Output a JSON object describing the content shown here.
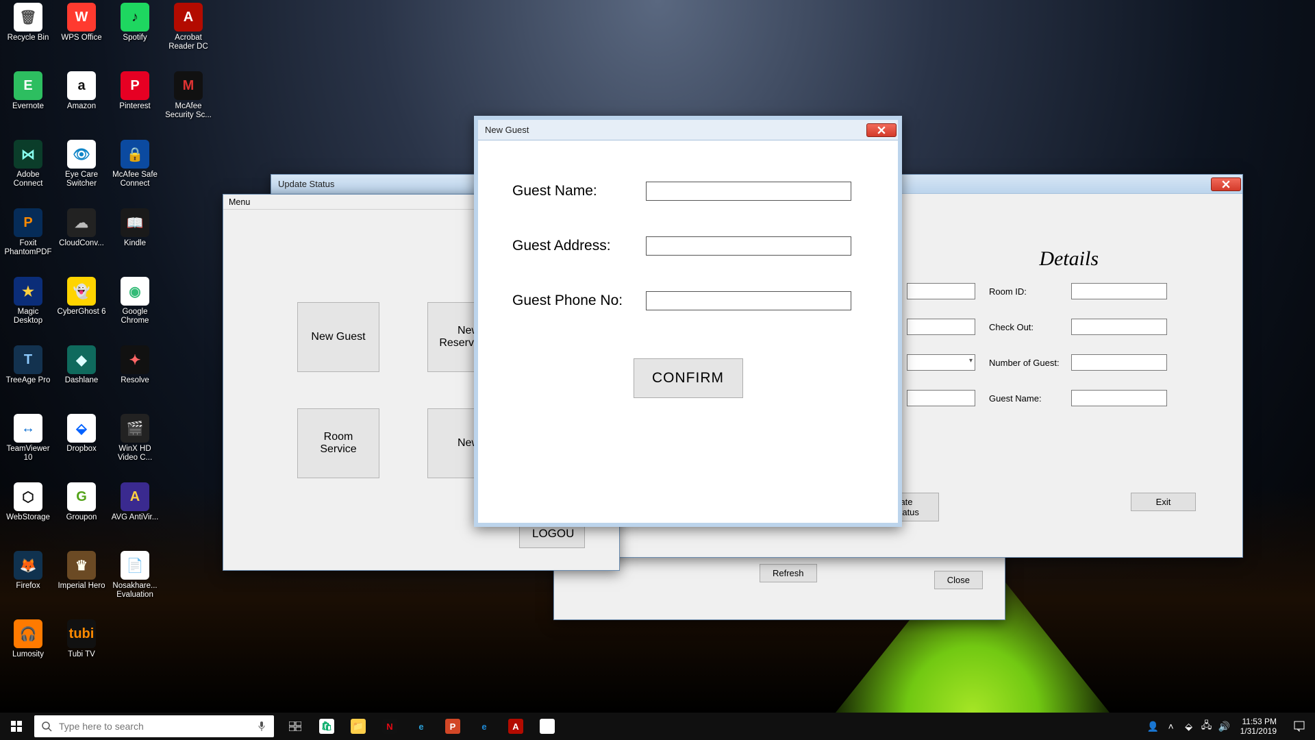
{
  "desktop_icons": {
    "col0": [
      {
        "label": "Recycle Bin",
        "bg": "#ffffff",
        "fg": "#505050",
        "ch": "🗑"
      },
      {
        "label": "Evernote",
        "bg": "#2dbe60",
        "fg": "#fff",
        "ch": "E"
      },
      {
        "label": "Adobe Connect",
        "bg": "#0b3d2a",
        "fg": "#8fe",
        "ch": "⋈"
      },
      {
        "label": "Foxit PhantomPDF",
        "bg": "#062c58",
        "fg": "#ff8a00",
        "ch": "P"
      },
      {
        "label": "Magic Desktop",
        "bg": "#0b2d78",
        "fg": "#ffd040",
        "ch": "★"
      },
      {
        "label": "TreeAge Pro",
        "bg": "#13324f",
        "fg": "#8ecbff",
        "ch": "T"
      },
      {
        "label": "TeamViewer 10",
        "bg": "#ffffff",
        "fg": "#0a6ed1",
        "ch": "↔"
      },
      {
        "label": "WebStorage",
        "bg": "#ffffff",
        "fg": "#111",
        "ch": "⬡"
      },
      {
        "label": "Firefox",
        "bg": "#10324f",
        "fg": "#ff8a00",
        "ch": "🦊"
      },
      {
        "label": "Lumosity",
        "bg": "#ff7a00",
        "fg": "#fff",
        "ch": "🎧"
      }
    ],
    "col1": [
      {
        "label": "WPS Office",
        "bg": "#ff3a2f",
        "fg": "#fff",
        "ch": "W"
      },
      {
        "label": "Amazon",
        "bg": "#ffffff",
        "fg": "#111",
        "ch": "a"
      },
      {
        "label": "Eye Care Switcher",
        "bg": "#ffffff",
        "fg": "#1186c8",
        "ch": "👁"
      },
      {
        "label": "CloudConv...",
        "bg": "#222222",
        "fg": "#bbb",
        "ch": "☁"
      },
      {
        "label": "CyberGhost 6",
        "bg": "#ffd400",
        "fg": "#111",
        "ch": "👻"
      },
      {
        "label": "Dashlane",
        "bg": "#0f6a5d",
        "fg": "#dff",
        "ch": "◆"
      },
      {
        "label": "Dropbox",
        "bg": "#ffffff",
        "fg": "#0061ff",
        "ch": "⬙"
      },
      {
        "label": "Groupon",
        "bg": "#ffffff",
        "fg": "#53a318",
        "ch": "G"
      },
      {
        "label": "Imperial Hero",
        "bg": "#6b4a24",
        "fg": "#ffe",
        "ch": "♛"
      },
      {
        "label": "Tubi TV",
        "bg": "#111",
        "fg": "#ff8a00",
        "ch": "tubi"
      }
    ],
    "col2": [
      {
        "label": "Spotify",
        "bg": "#1ed760",
        "fg": "#111",
        "ch": "♪"
      },
      {
        "label": "Pinterest",
        "bg": "#e60023",
        "fg": "#fff",
        "ch": "P"
      },
      {
        "label": "McAfee Safe Connect",
        "bg": "#0b4aa0",
        "fg": "#fff",
        "ch": "🔒"
      },
      {
        "label": "Kindle",
        "bg": "#1a1a1a",
        "fg": "#3cf",
        "ch": "📖"
      },
      {
        "label": "Google Chrome",
        "bg": "#ffffff",
        "fg": "#3b7",
        "ch": "◉"
      },
      {
        "label": "Resolve",
        "bg": "#111",
        "fg": "#f66",
        "ch": "✦"
      },
      {
        "label": "WinX HD Video C...",
        "bg": "#222",
        "fg": "#7ad",
        "ch": "🎬"
      },
      {
        "label": "AVG AntiVir...",
        "bg": "#3a2a8f",
        "fg": "#ffd040",
        "ch": "A"
      },
      {
        "label": "Nosakhare... Evaluation",
        "bg": "#ffffff",
        "fg": "#222",
        "ch": "📄"
      }
    ],
    "col3": [
      {
        "label": "Acrobat Reader DC",
        "bg": "#b30b00",
        "fg": "#fff",
        "ch": "A"
      },
      {
        "label": "McAfee Security Sc...",
        "bg": "#111",
        "fg": "#d33",
        "ch": "M"
      }
    ]
  },
  "menu_window": {
    "menubar": "Menu",
    "buttons": {
      "new_guest": "New Guest",
      "new_reservation": "New\nReservation",
      "room_service": "Room\nService",
      "new_partial": "New",
      "logout": "LOGOU"
    }
  },
  "update_window": {
    "title": "Update Status",
    "details_title": "Details",
    "labels": {
      "room_id": "Room ID:",
      "check_out": "Check Out:",
      "num_guest": "Number of Guest:",
      "guest_name": "Guest Name:"
    },
    "buttons": {
      "update": "ate Status",
      "exit": "Exit"
    }
  },
  "back_window": {
    "buttons": {
      "refresh": "Refresh",
      "close": "Close"
    }
  },
  "new_guest_window": {
    "title": "New Guest",
    "labels": {
      "name": "Guest Name:",
      "address": "Guest Address:",
      "phone": "Guest Phone No:"
    },
    "confirm": "CONFIRM"
  },
  "taskbar": {
    "search_placeholder": "Type here to search",
    "time": "11:53 PM",
    "date": "1/31/2019"
  }
}
